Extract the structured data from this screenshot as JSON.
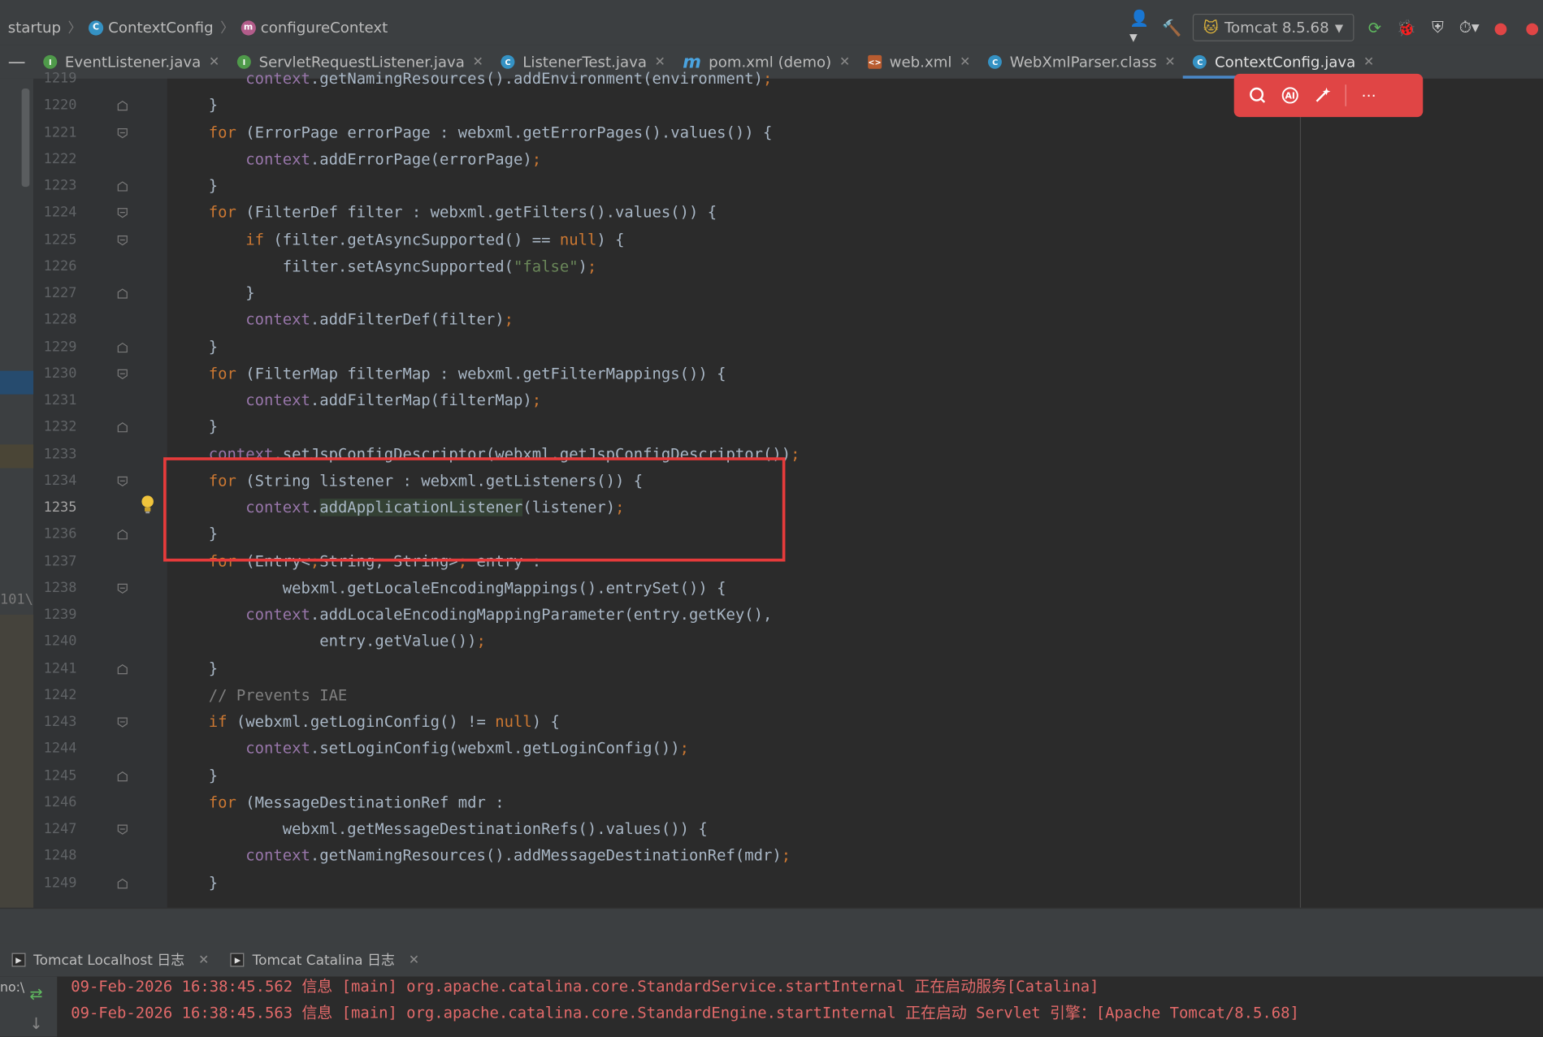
{
  "breadcrumbs": [
    "startup",
    "ContextConfig",
    "configureContext"
  ],
  "run_config": {
    "label": "Tomcat 8.5.68"
  },
  "tabs": [
    {
      "label": "EventListener.java",
      "icon": "interface-icon"
    },
    {
      "label": "ServletRequestListener.java",
      "icon": "interface-icon"
    },
    {
      "label": "ListenerTest.java",
      "icon": "class-icon"
    },
    {
      "label": "pom.xml (demo)",
      "icon": "maven-icon"
    },
    {
      "label": "web.xml",
      "icon": "xml-icon"
    },
    {
      "label": "WebXmlParser.class",
      "icon": "class-icon"
    },
    {
      "label": "ContextConfig.java",
      "icon": "class-icon",
      "active": true
    }
  ],
  "editor": {
    "current_line": 1235,
    "lines": [
      {
        "n": "1219",
        "code": "    context.getNamingResources().addEnvironment(environment);"
      },
      {
        "n": "1220",
        "code": "}"
      },
      {
        "n": "1221",
        "code": "for (ErrorPage errorPage : webxml.getErrorPages().values()) {"
      },
      {
        "n": "1222",
        "code": "    context.addErrorPage(errorPage);"
      },
      {
        "n": "1223",
        "code": "}"
      },
      {
        "n": "1224",
        "code": "for (FilterDef filter : webxml.getFilters().values()) {"
      },
      {
        "n": "1225",
        "code": "    if (filter.getAsyncSupported() == null) {"
      },
      {
        "n": "1226",
        "code": "        filter.setAsyncSupported(\"false\");"
      },
      {
        "n": "1227",
        "code": "    }"
      },
      {
        "n": "1228",
        "code": "    context.addFilterDef(filter);"
      },
      {
        "n": "1229",
        "code": "}"
      },
      {
        "n": "1230",
        "code": "for (FilterMap filterMap : webxml.getFilterMappings()) {"
      },
      {
        "n": "1231",
        "code": "    context.addFilterMap(filterMap);"
      },
      {
        "n": "1232",
        "code": "}"
      },
      {
        "n": "1233",
        "code": "context.setJspConfigDescriptor(webxml.getJspConfigDescriptor());"
      },
      {
        "n": "1234",
        "code": "for (String listener : webxml.getListeners()) {"
      },
      {
        "n": "1235",
        "code": "    context.addApplicationListener(listener);"
      },
      {
        "n": "1236",
        "code": "}"
      },
      {
        "n": "1237",
        "code": "for (Entry<String, String> entry :"
      },
      {
        "n": "1238",
        "code": "        webxml.getLocaleEncodingMappings().entrySet()) {"
      },
      {
        "n": "1239",
        "code": "    context.addLocaleEncodingMappingParameter(entry.getKey(),"
      },
      {
        "n": "1240",
        "code": "            entry.getValue());"
      },
      {
        "n": "1241",
        "code": "}"
      },
      {
        "n": "1242",
        "code": "// Prevents IAE"
      },
      {
        "n": "1243",
        "code": "if (webxml.getLoginConfig() != null) {"
      },
      {
        "n": "1244",
        "code": "    context.setLoginConfig(webxml.getLoginConfig());"
      },
      {
        "n": "1245",
        "code": "}"
      },
      {
        "n": "1246",
        "code": "for (MessageDestinationRef mdr :"
      },
      {
        "n": "1247",
        "code": "        webxml.getMessageDestinationRefs().values()) {"
      },
      {
        "n": "1248",
        "code": "    context.getNamingResources().addMessageDestinationRef(mdr);"
      },
      {
        "n": "1249",
        "code": "}"
      }
    ]
  },
  "bottom_tabs": [
    {
      "label": "Tomcat Localhost 日志"
    },
    {
      "label": "Tomcat Catalina 日志"
    }
  ],
  "console": {
    "gutter_label": "no:\\",
    "lines": [
      "09-Feb-2026 16:38:45.562 信息 [main] org.apache.catalina.core.StandardService.startInternal 正在启动服务[Catalina]",
      "09-Feb-2026 16:38:45.563 信息 [main] org.apache.catalina.core.StandardEngine.startInternal 正在启动 Servlet 引擎：[Apache Tomcat/8.5.68]"
    ]
  },
  "side_panel": {
    "path_fragment": "101\\"
  },
  "colors": {
    "keyword": "#cc7832",
    "string": "#6a8759",
    "field": "#9876aa",
    "comment": "#808080",
    "highlight_box": "#e63b3b"
  }
}
